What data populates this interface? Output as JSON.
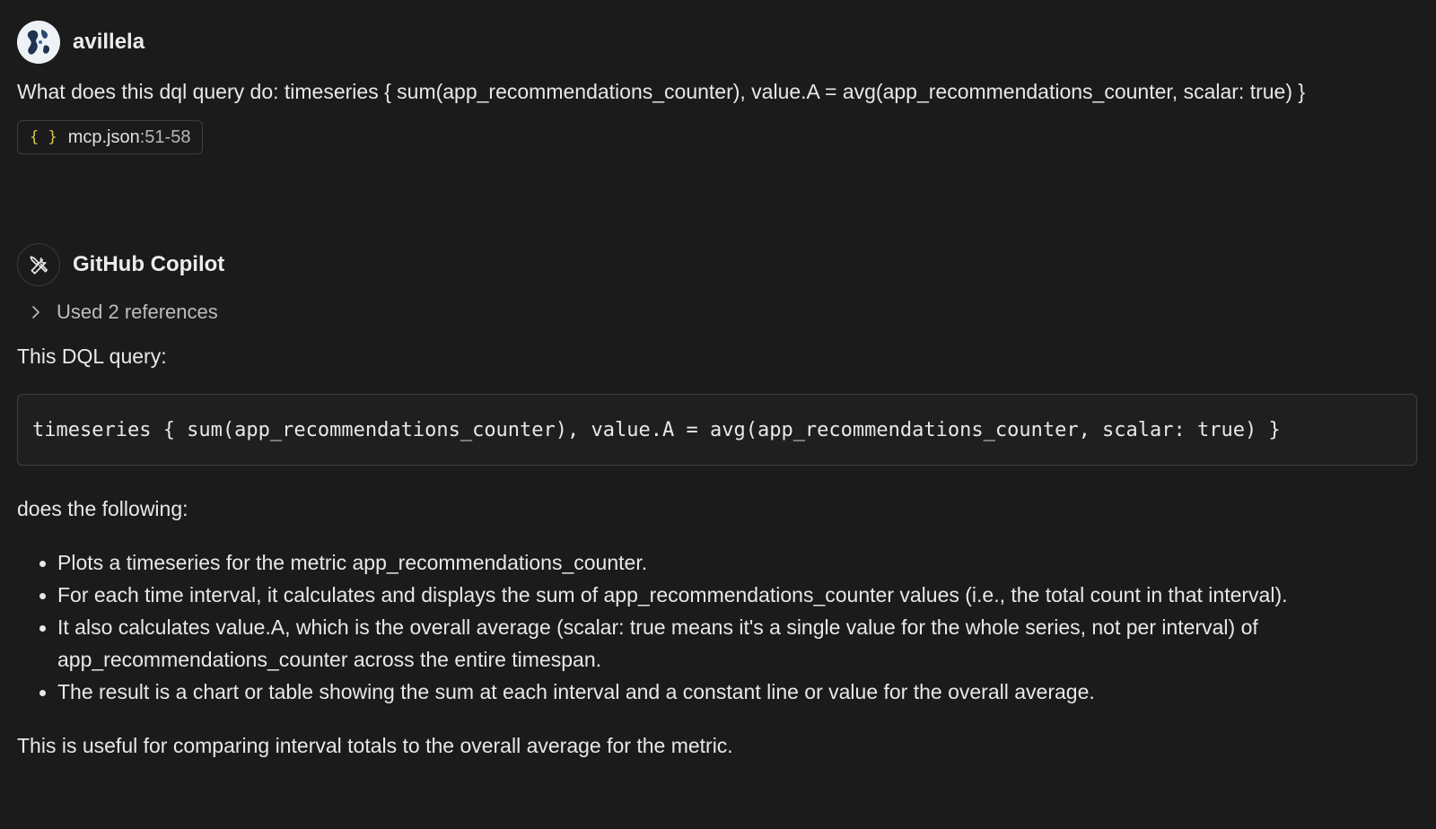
{
  "user_message": {
    "author": "avillela",
    "text": "What does this dql query do: timeseries { sum(app_recommendations_counter), value.A = avg(app_recommendations_counter, scalar: true) }",
    "reference": {
      "file": "mcp.json",
      "range": ":51-58"
    }
  },
  "bot_message": {
    "author": "GitHub Copilot",
    "used_references": "Used 2 references",
    "intro": "This DQL query:",
    "code": "timeseries { sum(app_recommendations_counter), value.A = avg(app_recommendations_counter, scalar: true) }",
    "followup": "does the following:",
    "bullets": [
      "Plots a timeseries for the metric app_recommendations_counter.",
      "For each time interval, it calculates and displays the sum of app_recommendations_counter values (i.e., the total count in that interval).",
      "It also calculates value.A, which is the overall average (scalar: true means it's a single value for the whole series, not per interval) of app_recommendations_counter across the entire timespan.",
      "The result is a chart or table showing the sum at each interval and a constant line or value for the overall average."
    ],
    "conclusion": "This is useful for comparing interval totals to the overall average for the metric."
  },
  "icons": {
    "user_avatar": "avatar-icon",
    "bot_avatar": "tools-icon",
    "file_type": "json-braces-icon",
    "expand": "chevron-right-icon"
  }
}
